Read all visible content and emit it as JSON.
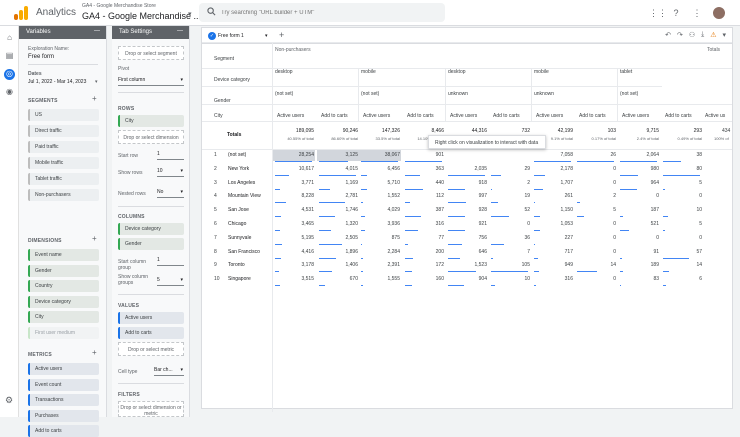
{
  "app": {
    "name": "Analytics",
    "account_small": "GA4 - Google Merchandise Store",
    "account_big": "GA4 - Google Merchandise ...",
    "search_placeholder": "Try searching \"URL builder + UTM\""
  },
  "variables": {
    "header": "Variables",
    "exploration_label": "Exploration Name:",
    "exploration_name": "Free form",
    "dates_label": "Dates",
    "dates_value": "Jul 1, 2022 - Mar 14, 2023",
    "segments_title": "SEGMENTS",
    "segments": [
      "US",
      "Direct traffic",
      "Paid traffic",
      "Mobile traffic",
      "Tablet traffic",
      "Non-purchasers"
    ],
    "dimensions_title": "DIMENSIONS",
    "dimensions": [
      "Event name",
      "Gender",
      "Country",
      "Device category",
      "City"
    ],
    "dimensions_ghost": "First user medium",
    "metrics_title": "METRICS",
    "metrics": [
      "Active users",
      "Event count",
      "Transactions",
      "Purchases",
      "Add to carts"
    ]
  },
  "tab_settings": {
    "header": "Tab Settings",
    "segment_drop": "Drop or select segment",
    "pivot_label": "Pivot",
    "pivot_value": "First column",
    "rows_title": "ROWS",
    "rows_chip": "City",
    "rows_drop": "Drop or select dimension",
    "start_row_label": "Start row",
    "start_row_value": "1",
    "show_rows_label": "Show rows",
    "show_rows_value": "10",
    "nested_rows_label": "Nested rows",
    "nested_rows_value": "No",
    "columns_title": "COLUMNS",
    "columns_chips": [
      "Device category",
      "Gender"
    ],
    "start_col_label": "Start column group",
    "start_col_value": "1",
    "show_col_label": "Show column groups",
    "show_col_value": "5",
    "values_title": "VALUES",
    "values_chips": [
      "Active users",
      "Add to carts"
    ],
    "metric_drop": "Drop or select metric",
    "cell_type_label": "Cell type",
    "cell_type_value": "Bar ch...",
    "filters_title": "FILTERS",
    "filters_drop": "Drop or select dimension or metric"
  },
  "canvas": {
    "tab_name": "Free form 1",
    "segment_header": "Segment",
    "segment_value": "Non-purchasers",
    "device_header": "Device category",
    "gender_header": "Gender",
    "city_header": "City",
    "totals_header": "Totals",
    "devices": [
      "desktop",
      "mobile",
      "desktop",
      "mobile",
      "tablet"
    ],
    "genders": [
      "(not set)",
      "(not set)",
      "unknown",
      "unknown",
      "(not set)"
    ],
    "metric_heads": [
      "Active users",
      "Add to carts",
      "Active users",
      "Add to carts",
      "Active users",
      "Add to carts",
      "Active users",
      "Add to carts",
      "Active users",
      "Add to carts"
    ],
    "totals": [
      "189,095",
      "90,246",
      "147,326",
      "8,466",
      "44,316",
      "732",
      "42,199",
      "103",
      "9,715",
      "293"
    ],
    "totals_pct": [
      "40.55% of total",
      "86.60% of total",
      "33.5% of total",
      "14.10% of total",
      "",
      "",
      "9.1% of total",
      "0.17% of total",
      "2.4% of total",
      "0.49% of total"
    ],
    "rows": [
      {
        "rank": "1",
        "city": "(not set)",
        "values": [
          "28,254",
          "3,125",
          "38,067",
          "901",
          "",
          "",
          "7,058",
          "26",
          "2,064",
          "38"
        ]
      },
      {
        "rank": "2",
        "city": "New York",
        "values": [
          "10,617",
          "4,015",
          "6,456",
          "363",
          "2,035",
          "29",
          "2,178",
          "0",
          "980",
          "80"
        ]
      },
      {
        "rank": "3",
        "city": "Los Angeles",
        "values": [
          "3,771",
          "1,169",
          "5,710",
          "440",
          "918",
          "2",
          "1,707",
          "0",
          "964",
          "5"
        ]
      },
      {
        "rank": "4",
        "city": "Mountain View",
        "values": [
          "8,228",
          "2,781",
          "1,552",
          "112",
          "997",
          "19",
          "261",
          "2",
          "0",
          "0"
        ]
      },
      {
        "rank": "5",
        "city": "San Jose",
        "values": [
          "4,531",
          "1,746",
          "4,029",
          "387",
          "928",
          "52",
          "1,150",
          "5",
          "187",
          "10"
        ]
      },
      {
        "rank": "6",
        "city": "Chicago",
        "values": [
          "3,465",
          "1,320",
          "3,936",
          "316",
          "921",
          "0",
          "1,053",
          "0",
          "521",
          "5"
        ]
      },
      {
        "rank": "7",
        "city": "Sunnyvale",
        "values": [
          "5,195",
          "2,505",
          "875",
          "77",
          "756",
          "36",
          "227",
          "0",
          "0",
          "0"
        ]
      },
      {
        "rank": "8",
        "city": "San Francisco",
        "values": [
          "4,416",
          "1,896",
          "2,284",
          "200",
          "646",
          "7",
          "717",
          "0",
          "91",
          "57"
        ]
      },
      {
        "rank": "9",
        "city": "Toronto",
        "values": [
          "3,178",
          "1,406",
          "2,391",
          "172",
          "1,523",
          "105",
          "949",
          "14",
          "189",
          "14"
        ]
      },
      {
        "rank": "10",
        "city": "Singapore",
        "values": [
          "3,515",
          "670",
          "1,555",
          "160",
          "904",
          "10",
          "316",
          "0",
          "83",
          "6"
        ]
      }
    ],
    "overflow_header": "Totals",
    "overflow_metric": "Active us",
    "overflow_total": "434",
    "overflow_pct": "100% of",
    "tooltip": "Right click on visualization to interact with data"
  }
}
